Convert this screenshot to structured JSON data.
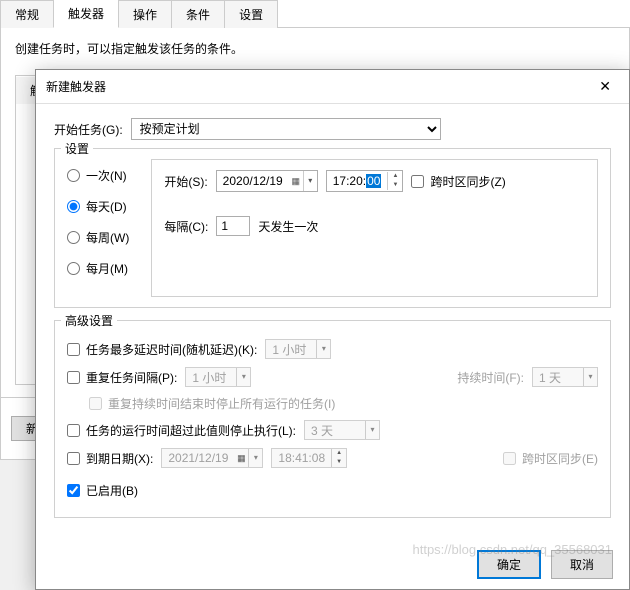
{
  "bg": {
    "tabs": [
      "常规",
      "触发器",
      "操作",
      "条件",
      "设置"
    ],
    "active_tab": "触发器",
    "description": "创建任务时，可以指定触发该任务的条件。",
    "inner_tab": "触发器",
    "new_button": "新建"
  },
  "dialog": {
    "title": "新建触发器",
    "begin_task_label": "开始任务(G):",
    "begin_task_value": "按预定计划",
    "settings_label": "设置",
    "frequency": {
      "once": "一次(N)",
      "daily": "每天(D)",
      "weekly": "每周(W)",
      "monthly": "每月(M)"
    },
    "start_label": "开始(S):",
    "start_date": "2020/12/19",
    "start_time_prefix": "17:20:",
    "start_time_seconds": "00",
    "sync_tz": "跨时区同步(Z)",
    "interval_label": "每隔(C):",
    "interval_value": "1",
    "interval_suffix": "天发生一次",
    "advanced_label": "高级设置",
    "adv": {
      "delay_label": "任务最多延迟时间(随机延迟)(K):",
      "delay_value": "1 小时",
      "repeat_label": "重复任务间隔(P):",
      "repeat_value": "1 小时",
      "duration_label": "持续时间(F):",
      "duration_value": "1 天",
      "stop_all_label": "重复持续时间结束时停止所有运行的任务(I)",
      "stop_after_label": "任务的运行时间超过此值则停止执行(L):",
      "stop_after_value": "3 天",
      "expire_label": "到期日期(X):",
      "expire_date": "2021/12/19",
      "expire_time": "18:41:08",
      "expire_sync_tz": "跨时区同步(E)",
      "enabled_label": "已启用(B)"
    },
    "ok": "确定",
    "cancel": "取消"
  },
  "watermark": "https://blog.csdn.net/qq_35568031"
}
